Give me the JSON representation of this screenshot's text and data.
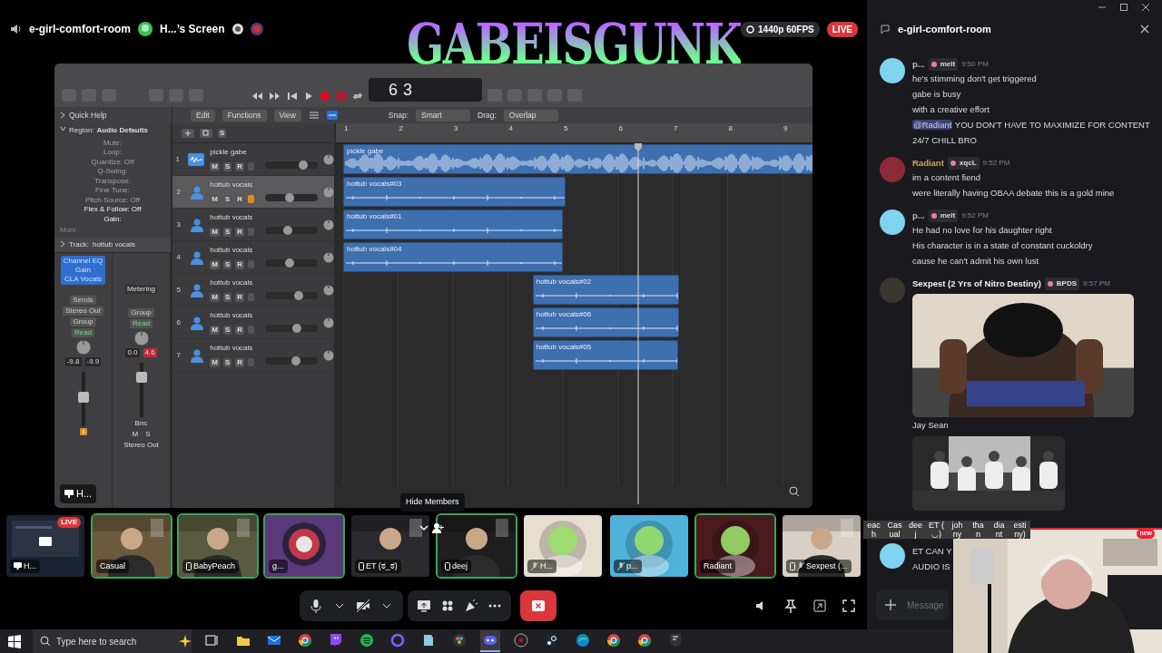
{
  "header": {
    "channel": "e-girl-comfort-room",
    "stream": "H...’s Screen",
    "quality": "1440p 60FPS",
    "live": "LIVE"
  },
  "overlay_logo": "GABEISGUNK",
  "daw": {
    "counter": [
      "6",
      "3"
    ],
    "menus": [
      "Edit",
      "Functions",
      "View"
    ],
    "snap": {
      "label": "Snap:",
      "value": "Smart"
    },
    "drag": {
      "label": "Drag:",
      "value": "Overlap"
    },
    "inspector": {
      "quick_help": "Quick Help",
      "region_label": "Region:",
      "region_value": "Audio Defaults",
      "params": [
        {
          "label": "Mute:",
          "disabled": true
        },
        {
          "label": "Loop:",
          "disabled": true
        },
        {
          "label": "Quantize:",
          "value": "Off",
          "disabled": true
        },
        {
          "label": "Q-Swing:",
          "disabled": true
        },
        {
          "label": "Transpose:",
          "disabled": true
        },
        {
          "label": "Fine Tune:",
          "disabled": true
        },
        {
          "label": "Pitch Source:",
          "value": "Off",
          "disabled": true
        },
        {
          "label": "Flex & Follow:",
          "value": "Off",
          "disabled": false
        },
        {
          "label": "Gain:",
          "disabled": false
        }
      ],
      "more": "More",
      "track_label": "Track:",
      "track_value": "hottub vocals"
    },
    "strips": [
      {
        "plugins": [
          "Channel EQ",
          "Gain",
          "CLA Vocals"
        ],
        "sends": "Sends",
        "output": "Stereo Out",
        "group": "Group",
        "automation": "Read",
        "readouts": [
          {
            "text": "-9.8",
            "clip": false
          },
          {
            "text": "-9.9",
            "clip": false
          }
        ],
        "level": 0.55,
        "input_monitor": true
      },
      {
        "slot": "Metering",
        "group": "Group",
        "automation": "Read",
        "readouts": [
          {
            "text": "0.0",
            "clip": false
          },
          {
            "text": "4.6",
            "clip": true
          }
        ],
        "level": 0.8,
        "bounce": "Bnc",
        "mute": "M",
        "solo": "S",
        "name": "Stereo Out"
      }
    ],
    "stage_label": "H...",
    "ruler": [
      "1",
      "2",
      "3",
      "4",
      "5",
      "6",
      "7",
      "8",
      "9"
    ],
    "playhead": {
      "level": 0.64
    },
    "header_buttons": [
      "S"
    ],
    "tracks": [
      {
        "number": "1",
        "name": "pickle gabe",
        "kind": "audio",
        "selected": false,
        "input_monitor": false,
        "level": 0.78,
        "buttons": [
          "M",
          "S",
          "R"
        ],
        "region": {
          "name": "pickle gabe",
          "kind": "loop"
        }
      },
      {
        "number": "2",
        "name": "hottub vocals",
        "kind": "vocal",
        "selected": true,
        "input_monitor": true,
        "level": 0.45,
        "buttons": [
          "M",
          "S",
          "R"
        ],
        "region": {
          "name": "hottub vocals#03",
          "kind": "take"
        }
      },
      {
        "number": "3",
        "name": "hottub vocals",
        "kind": "vocal",
        "selected": false,
        "input_monitor": false,
        "level": 0.42,
        "buttons": [
          "M",
          "S",
          "R"
        ],
        "region": {
          "name": "hottub vocals#01",
          "kind": "take"
        }
      },
      {
        "number": "4",
        "name": "hottub vocals",
        "kind": "vocal",
        "selected": false,
        "input_monitor": false,
        "level": 0.45,
        "buttons": [
          "M",
          "S",
          "R"
        ],
        "region": {
          "name": "hottub vocals#04",
          "kind": "take"
        }
      },
      {
        "number": "5",
        "name": "hottub vocals",
        "kind": "vocal",
        "selected": false,
        "input_monitor": false,
        "level": 0.67,
        "buttons": [
          "M",
          "S",
          "R"
        ],
        "region": {
          "name": "hottub vocals#02",
          "kind": "take"
        }
      },
      {
        "number": "6",
        "name": "hottub vocals",
        "kind": "vocal",
        "selected": false,
        "input_monitor": false,
        "level": 0.62,
        "buttons": [
          "M",
          "S",
          "R"
        ],
        "region": {
          "name": "hottub vocals#06",
          "kind": "take"
        }
      },
      {
        "number": "7",
        "name": "hottub vocals",
        "kind": "vocal",
        "selected": false,
        "input_monitor": false,
        "level": 0.6,
        "buttons": [
          "M",
          "S",
          "R"
        ],
        "region": {
          "name": "hottub vocals#05",
          "kind": "take"
        }
      }
    ]
  },
  "tooltip": "Hide Members",
  "participants": [
    {
      "name": "H...",
      "kind": "screen",
      "speaking": false,
      "sharing": true,
      "phone": false,
      "muted": false,
      "live": "LIVE",
      "color": "#1c2333"
    },
    {
      "name": "Casual",
      "kind": "person",
      "speaking": true,
      "sharing": false,
      "phone": false,
      "muted": false,
      "color": "#6b5a3e"
    },
    {
      "name": "BabyPeach",
      "kind": "person",
      "speaking": true,
      "sharing": false,
      "phone": true,
      "muted": false,
      "color": "#5a5a40"
    },
    {
      "name": "g...",
      "kind": "emblem",
      "speaking": true,
      "sharing": false,
      "phone": false,
      "muted": false,
      "color": "#5b3a7a"
    },
    {
      "name": "ET (ಠ_ಠ)",
      "kind": "person",
      "speaking": false,
      "sharing": false,
      "phone": true,
      "muted": false,
      "color": "#2a2a2e"
    },
    {
      "name": "deej",
      "kind": "person",
      "speaking": true,
      "sharing": false,
      "phone": true,
      "muted": false,
      "color": "#1e1e1e"
    },
    {
      "name": "H...",
      "kind": "avatar",
      "speaking": false,
      "sharing": false,
      "phone": false,
      "muted": true,
      "color": "#e6dfcf"
    },
    {
      "name": "p...",
      "kind": "avatar",
      "speaking": false,
      "sharing": false,
      "phone": false,
      "muted": true,
      "color": "#4fb3d9"
    },
    {
      "name": "Radiant",
      "kind": "avatar",
      "speaking": true,
      "sharing": false,
      "phone": false,
      "muted": false,
      "color": "#4a1a1e"
    },
    {
      "name": "Sexpest (...",
      "kind": "person",
      "speaking": false,
      "sharing": false,
      "phone": true,
      "muted": true,
      "color": "#d8d0c4"
    }
  ],
  "name_fragments": [
    {
      "top": "eac",
      "bottom": "h"
    },
    {
      "top": "Cas",
      "bottom": "ual"
    },
    {
      "top": "dee",
      "bottom": "j"
    },
    {
      "top": "ET (",
      "bottom": "◡)"
    },
    {
      "top": "joh",
      "bottom": "ny"
    },
    {
      "top": "tha",
      "bottom": "n"
    },
    {
      "top": "dia",
      "bottom": "nt"
    },
    {
      "top": "esti",
      "bottom": "ny)"
    }
  ],
  "chat": {
    "title": "e-girl-comfort-room",
    "placeholder": "Message",
    "messages": [
      {
        "author": {
          "name": "p...",
          "color": "#b5bac1"
        },
        "tag": "melt",
        "time": "9:50 PM",
        "avatar": {
          "color": "#7fd3ee"
        },
        "content": [
          {
            "kind": "text",
            "text": "he's stimming don't get triggered"
          },
          {
            "kind": "text",
            "text": "gabe is busy"
          },
          {
            "kind": "text",
            "text": "with a creative effort"
          },
          {
            "kind": "mention",
            "mention": "@Radiant",
            "text": "YOU DON'T HAVE TO MAXIMIZE FOR CONTENT 24/7 CHILL BRO"
          }
        ]
      },
      {
        "author": {
          "name": "Radiant",
          "color": "#c9a55b"
        },
        "tag": "xqcL",
        "time": "9:52 PM",
        "avatar": {
          "color": "#8c2a38"
        },
        "content": [
          {
            "kind": "text",
            "text": "im a content fiend"
          },
          {
            "kind": "text",
            "text": "were literally having OBAA debate this is a gold mine"
          }
        ]
      },
      {
        "author": {
          "name": "p...",
          "color": "#b5bac1"
        },
        "tag": "melt",
        "time": "9:52 PM",
        "avatar": {
          "color": "#7fd3ee"
        },
        "content": [
          {
            "kind": "text",
            "text": "He had no love for his daughter right"
          },
          {
            "kind": "text",
            "text": "His character is in a state of constant cuckoldry"
          },
          {
            "kind": "text",
            "text": "cause he can't admit his own lust"
          }
        ]
      },
      {
        "author": {
          "name": "Sexpest (2 Yrs of Nitro Destiny)",
          "color": "#f2f3f5"
        },
        "tag": "BPDS",
        "time": "9:57 PM",
        "avatar": {
          "color": "#3a3630"
        },
        "content": [
          {
            "kind": "gif_large"
          },
          {
            "kind": "title",
            "text": "Jay Sean"
          },
          {
            "kind": "gif_small"
          }
        ]
      },
      {
        "avatar": {
          "color": "#7fd3ee"
        },
        "content": [
          {
            "kind": "text",
            "text": "ET CAN Y"
          },
          {
            "kind": "text",
            "text": "AUDIO IS"
          }
        ]
      }
    ]
  },
  "webcam": {
    "badge": "new"
  },
  "taskbar": {
    "search_placeholder": "Type here to search",
    "apps": [
      {
        "kind": "taskview",
        "active": false
      },
      {
        "kind": "folder",
        "active": false
      },
      {
        "kind": "mail",
        "active": false
      },
      {
        "kind": "browser",
        "active": false
      },
      {
        "kind": "chat",
        "active": false
      },
      {
        "kind": "music",
        "active": false
      },
      {
        "kind": "ring",
        "active": false
      },
      {
        "kind": "note",
        "active": false
      },
      {
        "kind": "editor",
        "active": false
      },
      {
        "kind": "discord",
        "active": true
      },
      {
        "kind": "disc",
        "active": false
      },
      {
        "kind": "steam",
        "active": false
      },
      {
        "kind": "edge",
        "active": false
      },
      {
        "kind": "browser",
        "active": false
      },
      {
        "kind": "browser",
        "active": false
      },
      {
        "kind": "epic",
        "active": false
      }
    ]
  }
}
